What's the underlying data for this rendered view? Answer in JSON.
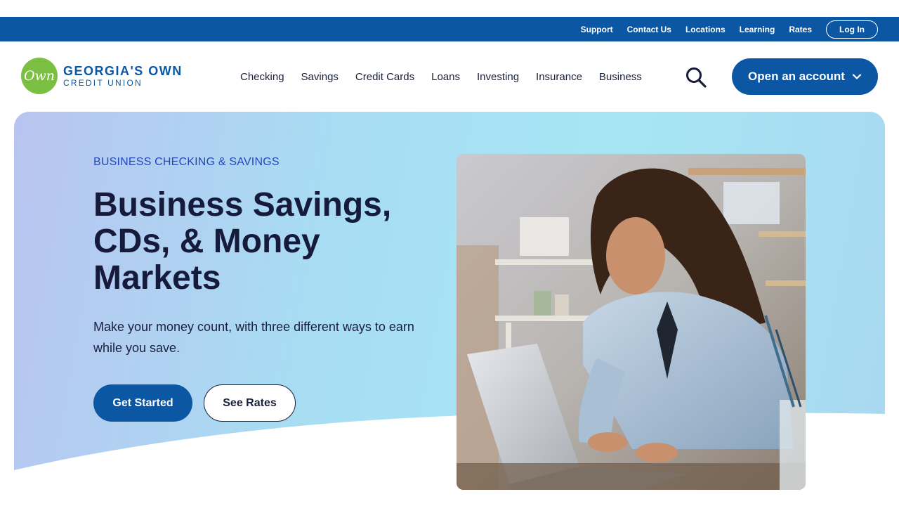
{
  "utility_nav": {
    "links": [
      "Support",
      "Contact Us",
      "Locations",
      "Learning",
      "Rates"
    ],
    "login_label": "Log In"
  },
  "logo": {
    "mark_text": "Own",
    "line1": "GEORGIA'S OWN",
    "line2": "CREDIT UNION"
  },
  "main_nav": {
    "items": [
      "Checking",
      "Savings",
      "Credit Cards",
      "Loans",
      "Investing",
      "Insurance",
      "Business"
    ],
    "cta_label": "Open an account"
  },
  "hero": {
    "eyebrow": "BUSINESS CHECKING & SAVINGS",
    "headline": "Business Savings, CDs, & Money Markets",
    "subtext": "Make your money count, with three different ways to earn while you save.",
    "primary_cta": "Get Started",
    "secondary_cta": "See Rates",
    "photo_alt": "Woman smiling while typing on a laptop in a studio"
  },
  "colors": {
    "brand_blue": "#0b57a4",
    "logo_green": "#7cc043",
    "eyebrow_blue": "#2448b8",
    "headline_navy": "#161a3b"
  },
  "icons": {
    "search": "search-icon",
    "cta_chevron": "chevron-down-icon"
  }
}
